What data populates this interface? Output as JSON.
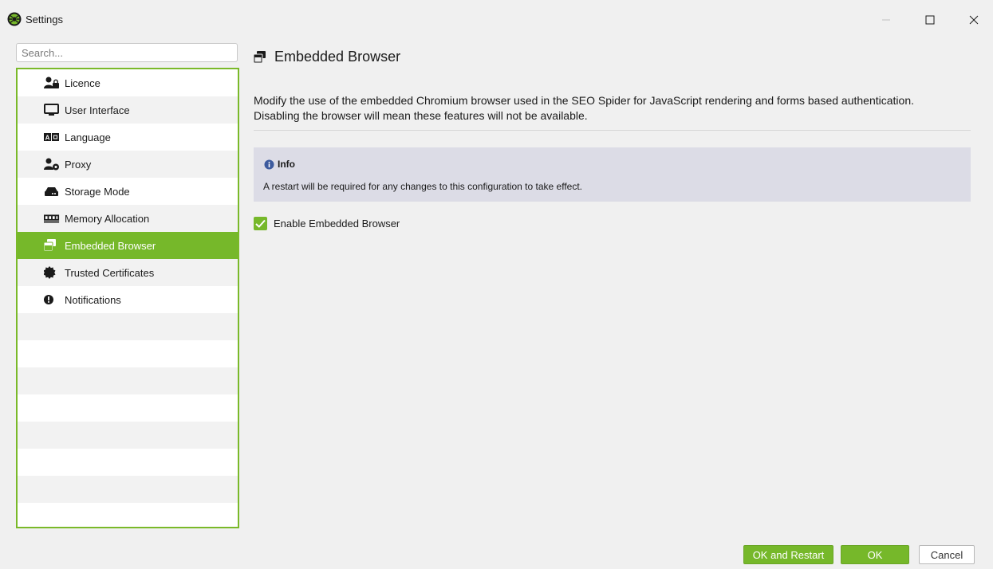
{
  "window": {
    "title": "Settings"
  },
  "search": {
    "placeholder": "Search..."
  },
  "sidebar": {
    "items": [
      {
        "label": "Licence",
        "icon": "user-lock-icon"
      },
      {
        "label": "User Interface",
        "icon": "monitor-icon"
      },
      {
        "label": "Language",
        "icon": "language-icon"
      },
      {
        "label": "Proxy",
        "icon": "user-gear-icon"
      },
      {
        "label": "Storage Mode",
        "icon": "hard-drive-icon"
      },
      {
        "label": "Memory Allocation",
        "icon": "memory-icon"
      },
      {
        "label": "Embedded Browser",
        "icon": "window-restore-icon",
        "selected": true
      },
      {
        "label": "Trusted Certificates",
        "icon": "certificate-icon"
      },
      {
        "label": "Notifications",
        "icon": "exclamation-circle-icon"
      }
    ]
  },
  "main": {
    "title": "Embedded Browser",
    "description": "Modify the use of the embedded Chromium browser used in the SEO Spider for JavaScript rendering and forms based authentication. Disabling the browser will mean these features will not be available.",
    "info": {
      "title": "Info",
      "text": "A restart will be required for any changes to this configuration to take effect."
    },
    "checkbox": {
      "label": "Enable Embedded Browser",
      "checked": true
    }
  },
  "footer": {
    "ok_restart_label": "OK and Restart",
    "ok_label": "OK",
    "cancel_label": "Cancel"
  },
  "colors": {
    "accent": "#76b82a",
    "info_background": "#dcdce6"
  }
}
